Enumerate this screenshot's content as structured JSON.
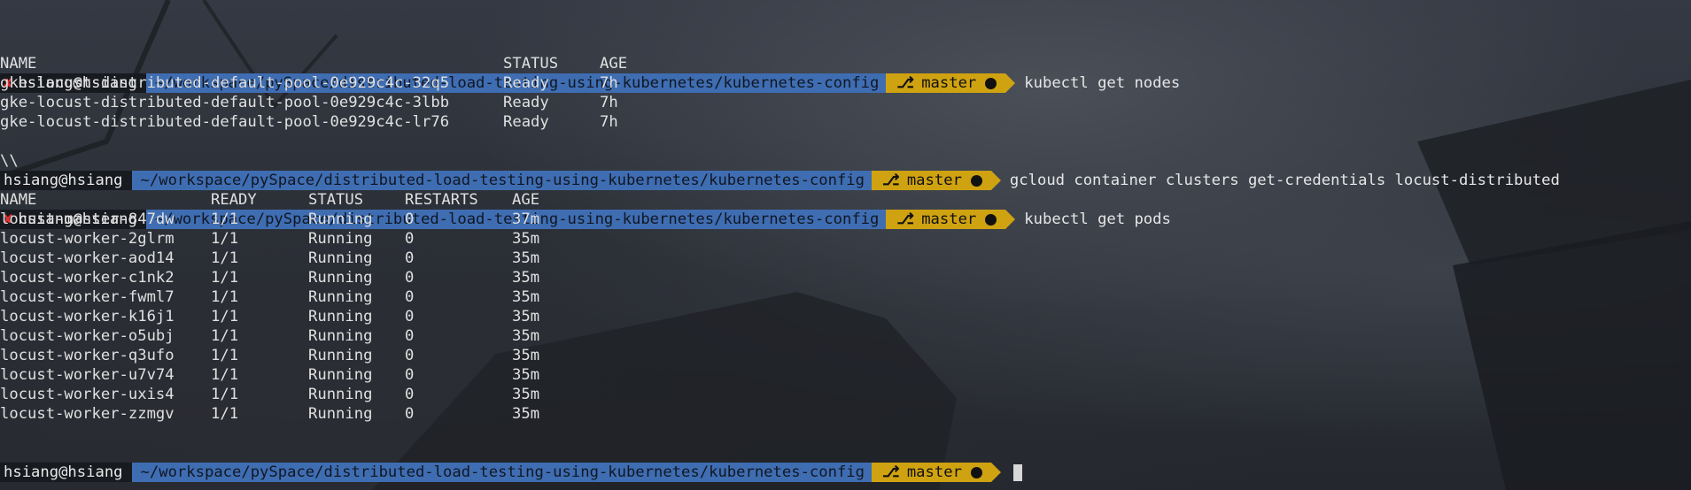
{
  "prompts": [
    {
      "error": true,
      "user": "hsiang@hsiang",
      "path": "~/workspace/pySpace/distributed-load-testing-using-kubernetes/kubernetes-config",
      "branch": "master",
      "command": "kubectl get nodes"
    },
    {
      "error": false,
      "user": "hsiang@hsiang",
      "path": "~/workspace/pySpace/distributed-load-testing-using-kubernetes/kubernetes-config",
      "branch": "master",
      "command": "gcloud container clusters get-credentials locust-distributed"
    },
    {
      "error": true,
      "user": "hsiang@hsiang",
      "path": "~/workspace/pySpace/distributed-load-testing-using-kubernetes/kubernetes-config",
      "branch": "master",
      "command": "kubectl get pods"
    },
    {
      "error": false,
      "user": "hsiang@hsiang",
      "path": "~/workspace/pySpace/distributed-load-testing-using-kubernetes/kubernetes-config",
      "branch": "master",
      "command": ""
    }
  ],
  "icons": {
    "error": "x-mark-icon",
    "branch": "git-branch-icon",
    "status": "dirty-dot-icon"
  },
  "colors": {
    "user_bg": "#171a1f",
    "path_bg": "#3f6db2",
    "git_bg": "#cfa211",
    "error": "#e03030"
  },
  "nodes": {
    "headers": [
      "NAME",
      "STATUS",
      "AGE"
    ],
    "rows": [
      [
        "gke-locust-distributed-default-pool-0e929c4c-32q5",
        "Ready",
        "7h"
      ],
      [
        "gke-locust-distributed-default-pool-0e929c4c-3lbb",
        "Ready",
        "7h"
      ],
      [
        "gke-locust-distributed-default-pool-0e929c4c-lr76",
        "Ready",
        "7h"
      ]
    ]
  },
  "continuation": "\\\\",
  "pods": {
    "headers": [
      "NAME",
      "READY",
      "STATUS",
      "RESTARTS",
      "AGE"
    ],
    "rows": [
      [
        "locust-master-847dw",
        "1/1",
        "Running",
        "0",
        "37m"
      ],
      [
        "locust-worker-2glrm",
        "1/1",
        "Running",
        "0",
        "35m"
      ],
      [
        "locust-worker-aod14",
        "1/1",
        "Running",
        "0",
        "35m"
      ],
      [
        "locust-worker-c1nk2",
        "1/1",
        "Running",
        "0",
        "35m"
      ],
      [
        "locust-worker-fwml7",
        "1/1",
        "Running",
        "0",
        "35m"
      ],
      [
        "locust-worker-k16j1",
        "1/1",
        "Running",
        "0",
        "35m"
      ],
      [
        "locust-worker-o5ubj",
        "1/1",
        "Running",
        "0",
        "35m"
      ],
      [
        "locust-worker-q3ufo",
        "1/1",
        "Running",
        "0",
        "35m"
      ],
      [
        "locust-worker-u7v74",
        "1/1",
        "Running",
        "0",
        "35m"
      ],
      [
        "locust-worker-uxis4",
        "1/1",
        "Running",
        "0",
        "35m"
      ],
      [
        "locust-worker-zzmgv",
        "1/1",
        "Running",
        "0",
        "35m"
      ]
    ]
  }
}
